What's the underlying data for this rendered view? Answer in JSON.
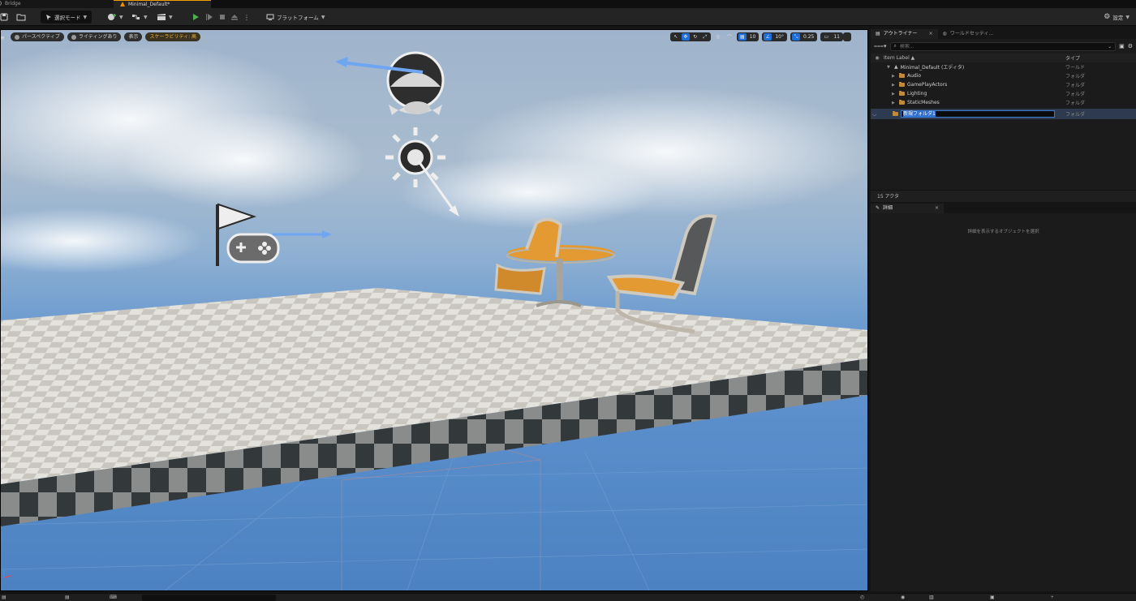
{
  "tabs": [
    {
      "label": "Bridge",
      "active": false
    },
    {
      "label": "Minimal_Default*",
      "active": true
    }
  ],
  "toolbar": {
    "mode_label": "選択モード",
    "platform_label": "プラットフォーム",
    "settings_label": "設定"
  },
  "viewport": {
    "perspective_label": "パースペクティブ",
    "lighting_label": "ライティングあり",
    "show_label": "表示",
    "scalability_label": "スケーラビリティ: 高",
    "grid_value": "10",
    "angle_value": "10°",
    "scale_value": "0.25",
    "camera_value": "11"
  },
  "outliner": {
    "tab_label": "アウトライナー",
    "world_settings_tab": "ワールドセッティ...",
    "search_placeholder": "検索...",
    "col_item_label": "Item Label ▲",
    "col_type": "タイプ",
    "rows": [
      {
        "label": "Minimal_Default (エディタ)",
        "type": "ワールド",
        "depth": 0,
        "icon": "world-icon"
      },
      {
        "label": "Audio",
        "type": "フォルダ",
        "depth": 1,
        "icon": "folder-icon"
      },
      {
        "label": "GamePlayActors",
        "type": "フォルダ",
        "depth": 1,
        "icon": "folder-icon"
      },
      {
        "label": "Lighting",
        "type": "フォルダ",
        "depth": 1,
        "icon": "folder-icon"
      },
      {
        "label": "StaticMeshes",
        "type": "フォルダ",
        "depth": 1,
        "icon": "folder-icon"
      }
    ],
    "new_folder_value": "新規フォルダ1",
    "new_folder_type": "フォルダ",
    "actor_count": "15 アクタ"
  },
  "details": {
    "tab_label": "詳細",
    "hint": "詳細を表示するオブジェクトを選択"
  },
  "colors": {
    "accent": "#1e6fd9",
    "scalability": "#f1b33a",
    "folder": "#c08a3a"
  }
}
